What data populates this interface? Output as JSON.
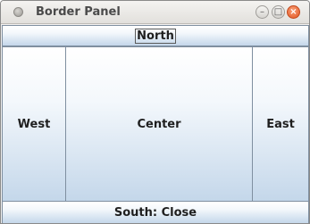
{
  "window": {
    "title": "Border Panel",
    "controls": {
      "minimize": "–",
      "maximize": "□",
      "close": "×"
    }
  },
  "panel": {
    "north": "North",
    "west": "West",
    "center": "Center",
    "east": "East",
    "south": "South: Close"
  }
}
